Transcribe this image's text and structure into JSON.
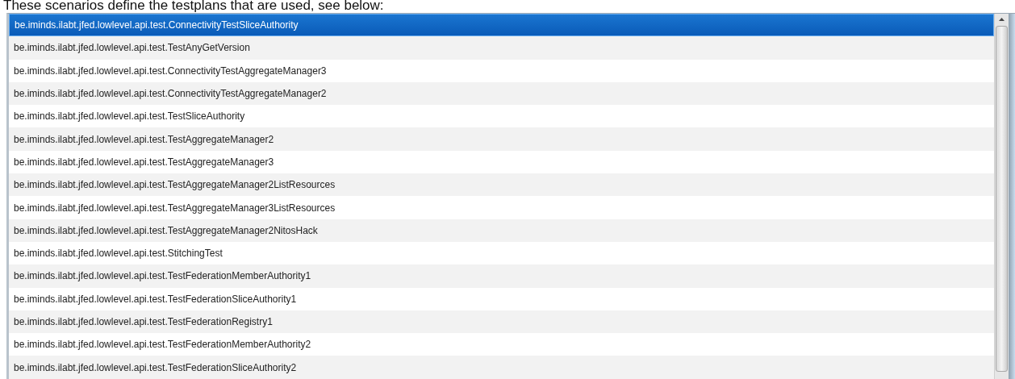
{
  "intro": "These scenarios define the testplans that are used, see below:",
  "list": {
    "items": [
      {
        "label": "be.iminds.ilabt.jfed.lowlevel.api.test.ConnectivityTestSliceAuthority",
        "selected": true
      },
      {
        "label": "be.iminds.ilabt.jfed.lowlevel.api.test.TestAnyGetVersion",
        "selected": false
      },
      {
        "label": "be.iminds.ilabt.jfed.lowlevel.api.test.ConnectivityTestAggregateManager3",
        "selected": false
      },
      {
        "label": "be.iminds.ilabt.jfed.lowlevel.api.test.ConnectivityTestAggregateManager2",
        "selected": false
      },
      {
        "label": "be.iminds.ilabt.jfed.lowlevel.api.test.TestSliceAuthority",
        "selected": false
      },
      {
        "label": "be.iminds.ilabt.jfed.lowlevel.api.test.TestAggregateManager2",
        "selected": false
      },
      {
        "label": "be.iminds.ilabt.jfed.lowlevel.api.test.TestAggregateManager3",
        "selected": false
      },
      {
        "label": "be.iminds.ilabt.jfed.lowlevel.api.test.TestAggregateManager2ListResources",
        "selected": false
      },
      {
        "label": "be.iminds.ilabt.jfed.lowlevel.api.test.TestAggregateManager3ListResources",
        "selected": false
      },
      {
        "label": "be.iminds.ilabt.jfed.lowlevel.api.test.TestAggregateManager2NitosHack",
        "selected": false
      },
      {
        "label": "be.iminds.ilabt.jfed.lowlevel.api.test.StitchingTest",
        "selected": false
      },
      {
        "label": "be.iminds.ilabt.jfed.lowlevel.api.test.TestFederationMemberAuthority1",
        "selected": false
      },
      {
        "label": "be.iminds.ilabt.jfed.lowlevel.api.test.TestFederationSliceAuthority1",
        "selected": false
      },
      {
        "label": "be.iminds.ilabt.jfed.lowlevel.api.test.TestFederationRegistry1",
        "selected": false
      },
      {
        "label": "be.iminds.ilabt.jfed.lowlevel.api.test.TestFederationMemberAuthority2",
        "selected": false
      },
      {
        "label": "be.iminds.ilabt.jfed.lowlevel.api.test.TestFederationSliceAuthority2",
        "selected": false
      }
    ]
  }
}
